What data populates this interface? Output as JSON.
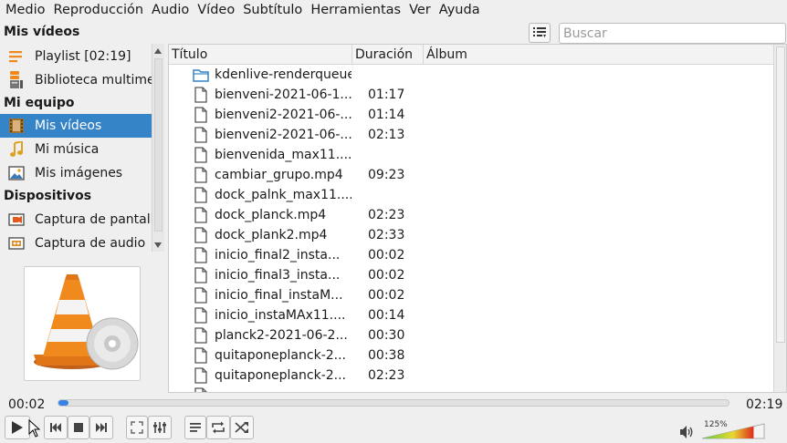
{
  "menu": [
    "Medio",
    "Reproducción",
    "Audio",
    "Vídeo",
    "Subtítulo",
    "Herramientas",
    "Ver",
    "Ayuda"
  ],
  "search": {
    "placeholder": "Buscar"
  },
  "sidebar": {
    "section_1": "Mis vídeos",
    "section_2": "Mi equipo",
    "section_3": "Dispositivos",
    "items": [
      {
        "label": "Playlist [02:19]",
        "icon": "playlist-icon"
      },
      {
        "label": "Biblioteca multimedia",
        "icon": "library-icon"
      },
      {
        "label": "Mis vídeos",
        "icon": "film-icon",
        "selected": true
      },
      {
        "label": "Mi música",
        "icon": "music-note-icon"
      },
      {
        "label": "Mis imágenes",
        "icon": "image-icon"
      },
      {
        "label": "Captura de pantalla",
        "icon": "screen-capture-icon"
      },
      {
        "label": "Captura de audio",
        "icon": "audio-capture-icon"
      }
    ]
  },
  "table": {
    "headers": [
      "Título",
      "Duración",
      "Álbum"
    ],
    "rows": [
      {
        "title": "kdenlive-renderqueue",
        "duration": "",
        "type": "folder"
      },
      {
        "title": "bienveni-2021-06-1...",
        "duration": "01:17",
        "type": "file"
      },
      {
        "title": "bienveni2-2021-06-...",
        "duration": "01:14",
        "type": "file"
      },
      {
        "title": "bienveni2-2021-06-...",
        "duration": "02:13",
        "type": "file"
      },
      {
        "title": "bienvenida_max11....",
        "duration": "",
        "type": "file"
      },
      {
        "title": "cambiar_grupo.mp4",
        "duration": "09:23",
        "type": "file"
      },
      {
        "title": "dock_palnk_max11....",
        "duration": "",
        "type": "file"
      },
      {
        "title": "dock_planck.mp4",
        "duration": "02:23",
        "type": "file"
      },
      {
        "title": "dock_plank2.mp4",
        "duration": "02:33",
        "type": "file"
      },
      {
        "title": "inicio_final2_insta...",
        "duration": "00:02",
        "type": "file"
      },
      {
        "title": "inicio_final3_insta...",
        "duration": "00:02",
        "type": "file"
      },
      {
        "title": "inicio_final_instaM...",
        "duration": "00:02",
        "type": "file"
      },
      {
        "title": "inicio_instaMAx11....",
        "duration": "00:14",
        "type": "file"
      },
      {
        "title": "planck2-2021-06-2...",
        "duration": "00:30",
        "type": "file"
      },
      {
        "title": "quitaponeplanck-2...",
        "duration": "00:38",
        "type": "file"
      },
      {
        "title": "quitaponeplanck-2...",
        "duration": "02:23",
        "type": "file"
      },
      {
        "title": "",
        "duration": "",
        "type": "file"
      }
    ]
  },
  "player": {
    "elapsed": "00:02",
    "total": "02:19",
    "progress_fraction": 0.015,
    "volume_label": "125%",
    "volume_fraction": 0.83
  },
  "colors": {
    "selection": "#3584c8",
    "accent": "#3584e4",
    "cone_orange": "#f08a1c"
  }
}
